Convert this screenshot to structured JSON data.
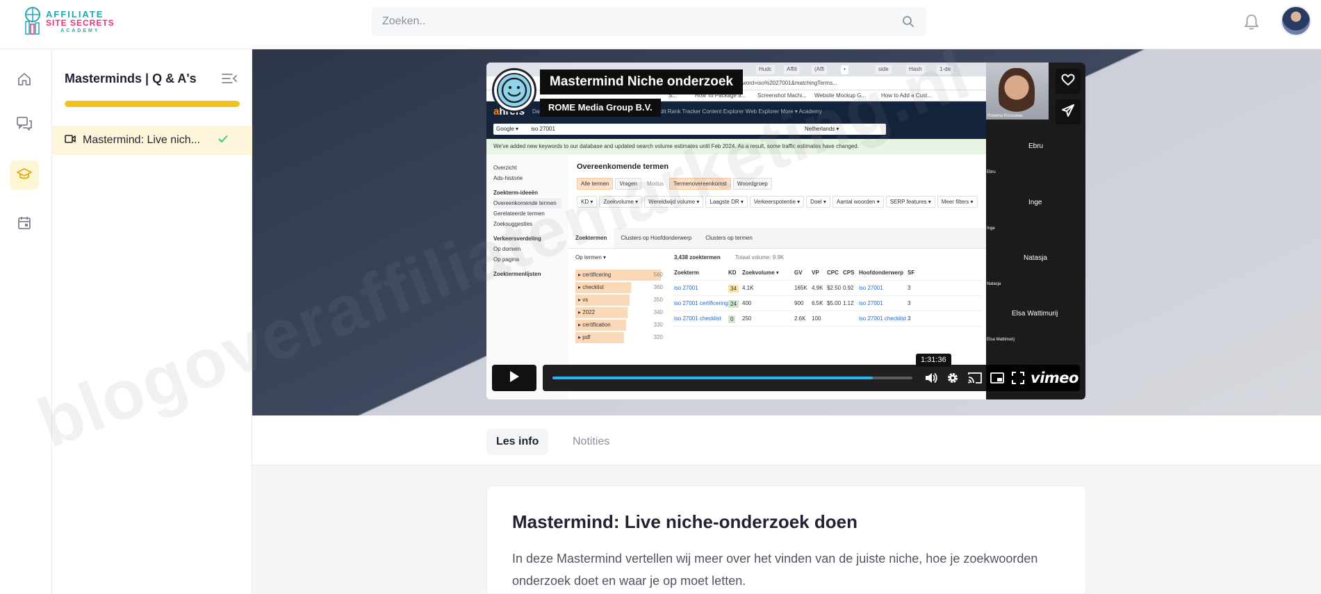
{
  "brand": {
    "line1": "AFFILIATE",
    "line2": "SITE SECRETS",
    "line3": "ACADEMY"
  },
  "search": {
    "placeholder": "Zoeken.."
  },
  "rail": {
    "items": [
      "home-icon",
      "chat-icon",
      "graduation-cap-icon",
      "calendar-icon"
    ],
    "active": "graduation-cap-icon"
  },
  "course": {
    "title": "Masterminds | Q & A's",
    "progress_percent": 100,
    "lessons": [
      {
        "label": "Mastermind: Live niche-onderzoek doen",
        "display": "Mastermind: Live nich...",
        "completed": true
      }
    ]
  },
  "video": {
    "overlay_title": "Mastermind Niche onderzoek",
    "overlay_subtitle": "ROME Media Group B.V.",
    "time_tooltip": "1:31:36",
    "played_fraction": 0.89,
    "brand": "vimeo",
    "screen": {
      "tabs": [
        "Hudc",
        "Affili",
        "(Affi",
        "• ",
        "side",
        "Hash",
        "1-de"
      ],
      "url": "word=iso%2027001&matchingTerms...",
      "bookmarks": [
        "S...",
        "How To Package a...",
        "Screenshot Machi...",
        "Website Mockup G...",
        "How to Add a Cust..."
      ],
      "ahrefs_brand_a": "a",
      "ahrefs_brand_rest": "hrefs",
      "nav": "Dashboard   Site Explorer   Keywords Explorer   Site Audit   Rank Tracker   Content Explorer   Web Explorer   More ▾   Academy",
      "engine": "Google ▾",
      "query": "iso 27001",
      "country": "Netherlands ▾",
      "notice": "We've added new keywords to our database and updated search volume estimates until Feb 2024. As a result, some traffic estimates have changed.",
      "left_menu": [
        "Overzicht",
        "Ads-historie"
      ],
      "left_h1": "Zoekterm-ideeën",
      "left_items1": [
        "Overeenkomende termen",
        "Gerelateerde termen",
        "Zoeksuggesties"
      ],
      "left_h2": "Verkeersverdeling",
      "left_items2": [
        "Op domein",
        "Op pagina"
      ],
      "left_h3": "Zoektermenlijsten",
      "main_title": "Overeenkomende termen",
      "chips": [
        "Alle termen",
        "Vragen",
        "Modus",
        "Termenovereenkomst",
        "Woordgroep"
      ],
      "filters": [
        "KD ▾",
        "Zoekvolume ▾",
        "Wereldwijd volume ▾",
        "Laagste DR ▾",
        "Verkeerspotentie ▾",
        "Doel ▾",
        "Aantal woorden ▾",
        "SERP features ▾",
        "Meer filters ▾"
      ],
      "subtabs": [
        "Zoektermen",
        "Clusters op Hoofdonderwerp",
        "Clusters op termen"
      ],
      "count": "3,438 zoektermen",
      "total": "Totaal volume: 9.9K",
      "sort": "Op termen ▾",
      "categories": [
        {
          "name": "certificering",
          "n": "560",
          "w": 95
        },
        {
          "name": "checklist",
          "n": "360",
          "w": 62
        },
        {
          "name": "vs",
          "n": "350",
          "w": 60
        },
        {
          "name": "2022",
          "n": "340",
          "w": 58
        },
        {
          "name": "certification",
          "n": "330",
          "w": 56
        },
        {
          "name": "pdf",
          "n": "320",
          "w": 54
        }
      ],
      "headers": [
        "Zoekterm",
        "KD",
        "Zoekvolume ▾",
        "GV",
        "VP",
        "CPC",
        "CPS",
        "Hoofdonderwerp",
        "SF"
      ],
      "rows": [
        [
          "iso 27001",
          "34",
          "4.1K",
          "165K",
          "4.9K",
          "$2.50",
          "0.92",
          "iso 27001",
          "3"
        ],
        [
          "iso 27001 certificering",
          "24",
          "400",
          "900",
          "6.5K",
          "$5.00",
          "1.12",
          "iso 27001",
          "3"
        ],
        [
          "iso 27001 checklist",
          "0",
          "250",
          "2.6K",
          "100",
          "",
          "",
          "iso 27001 checklist",
          "3"
        ]
      ],
      "people": [
        "Ebru",
        "Inge",
        "Natasja",
        "Elsa Wattimurij"
      ],
      "people_small": [
        "Ebru",
        "Inge",
        "Natasja",
        "Elsa Wattimurij"
      ],
      "cam_name": "Rowena Rousseau"
    }
  },
  "tabs": {
    "info": "Les info",
    "notes": "Notities"
  },
  "lesson": {
    "title": "Mastermind: Live niche-onderzoek doen",
    "description": "In deze Mastermind vertellen wij meer over het vinden van de juiste niche, hoe je zoekwoorden onderzoek doet en waar je op moet letten."
  },
  "watermark": "blogoveraffiliatemarketing.nl",
  "colors": {
    "accent_yellow": "#f5c21b",
    "active_bg": "#fdf6da",
    "brand_teal": "#1fa6b5",
    "brand_pink": "#e0357a",
    "check_green": "#3cc48a",
    "vimeo_blue": "#2ab5f0"
  }
}
